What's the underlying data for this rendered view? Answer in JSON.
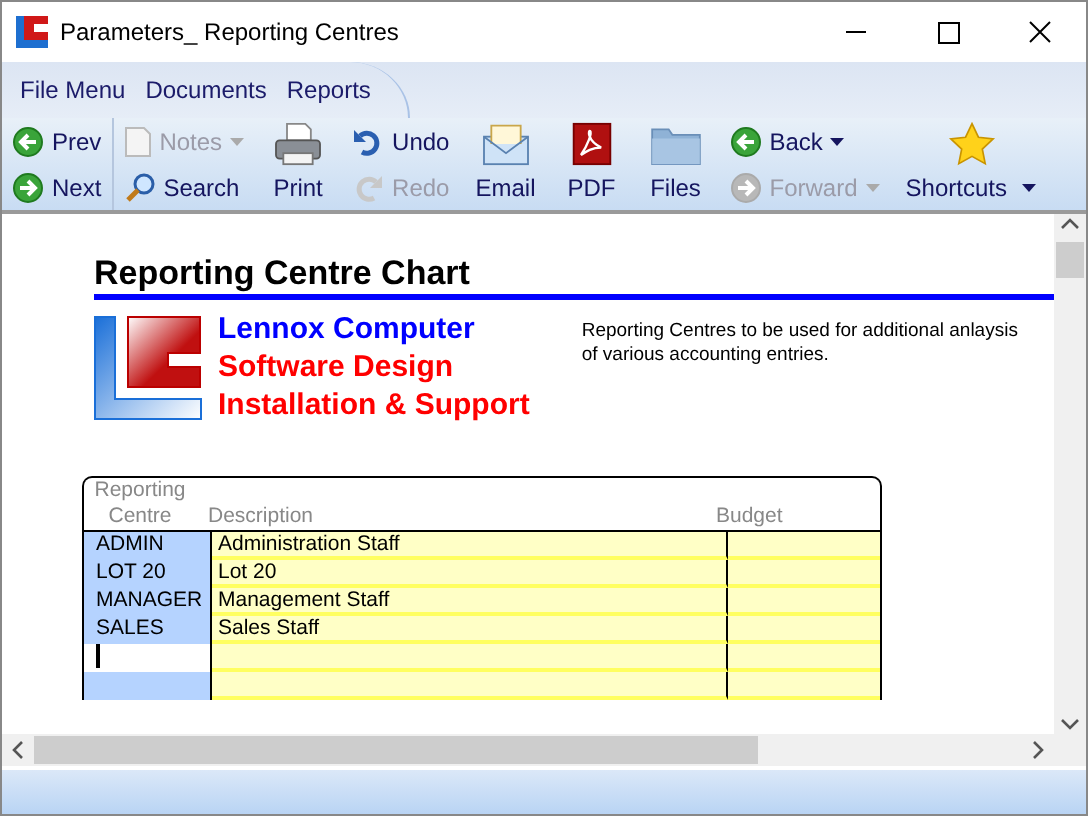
{
  "window": {
    "title": "Parameters_ Reporting Centres"
  },
  "menu": [
    {
      "label": "File Menu"
    },
    {
      "label": "Documents"
    },
    {
      "label": "Reports"
    }
  ],
  "toolbar": [
    {
      "kind": "stack",
      "items": [
        {
          "label": "Prev",
          "kind": "prev",
          "disabled": false,
          "dropdown": false
        },
        {
          "label": "Next",
          "kind": "next",
          "disabled": false,
          "dropdown": false
        }
      ]
    },
    {
      "kind": "stack",
      "items": [
        {
          "label": "Notes",
          "kind": "notes",
          "disabled": true,
          "dropdown": true
        },
        {
          "label": "Search",
          "kind": "search",
          "disabled": false,
          "dropdown": false
        }
      ]
    },
    {
      "kind": "large",
      "items": [
        {
          "label": "Print",
          "kind": "print",
          "dropdown": false
        }
      ]
    },
    {
      "kind": "stack",
      "items": [
        {
          "label": "Undo",
          "kind": "undo",
          "disabled": false,
          "dropdown": false
        },
        {
          "label": "Redo",
          "kind": "redo",
          "disabled": true,
          "dropdown": false
        }
      ]
    },
    {
      "kind": "large",
      "items": [
        {
          "label": "Email",
          "kind": "email",
          "dropdown": false
        }
      ]
    },
    {
      "kind": "large",
      "items": [
        {
          "label": "PDF",
          "kind": "pdf",
          "dropdown": false
        }
      ]
    },
    {
      "kind": "large",
      "items": [
        {
          "label": "Files",
          "kind": "folder",
          "dropdown": false
        }
      ]
    },
    {
      "kind": "stack",
      "items": [
        {
          "label": "Back",
          "kind": "prev",
          "disabled": false,
          "dropdown": true
        },
        {
          "label": "Forward",
          "kind": "next",
          "disabled": true,
          "dropdown": true
        }
      ]
    },
    {
      "kind": "large",
      "items": [
        {
          "label": "Shortcuts",
          "kind": "star",
          "dropdown": true
        }
      ]
    }
  ],
  "report": {
    "title": "Reporting Centre Chart",
    "company_lines": [
      {
        "text": "Lennox Computer",
        "color": "#0000ff"
      },
      {
        "text": "Software Design",
        "color": "#ff0000"
      },
      {
        "text": "Installation & Support",
        "color": "#ff0000"
      }
    ],
    "note": "Reporting Centres to be used for additional anlaysis of various accounting entries.",
    "table": {
      "columns": [
        "Reporting Centre",
        "Description",
        "Budget"
      ],
      "rows": [
        {
          "code": "ADMIN",
          "description": "Administration Staff",
          "editing": false
        },
        {
          "code": "LOT 20",
          "description": "Lot 20",
          "editing": false
        },
        {
          "code": "MANAGER",
          "description": "Management Staff",
          "editing": false
        },
        {
          "code": "SALES",
          "description": "Sales Staff",
          "editing": false
        },
        {
          "editing": true
        },
        {
          "editing": false
        }
      ]
    }
  }
}
